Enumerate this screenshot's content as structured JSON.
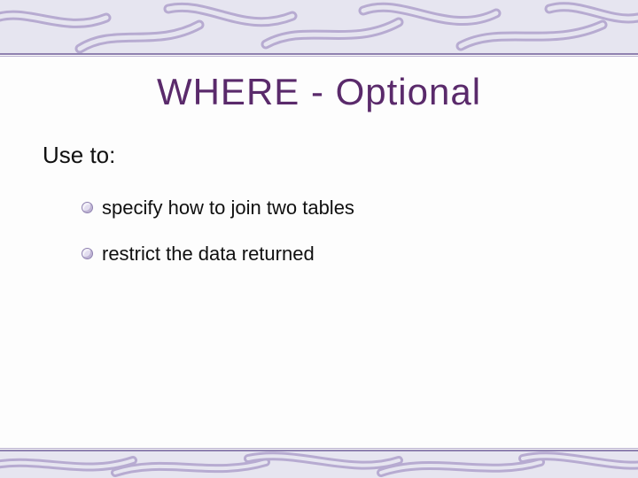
{
  "title": "WHERE - Optional",
  "intro": "Use to:",
  "bullets": [
    "specify how to join two tables",
    "restrict the data returned"
  ]
}
